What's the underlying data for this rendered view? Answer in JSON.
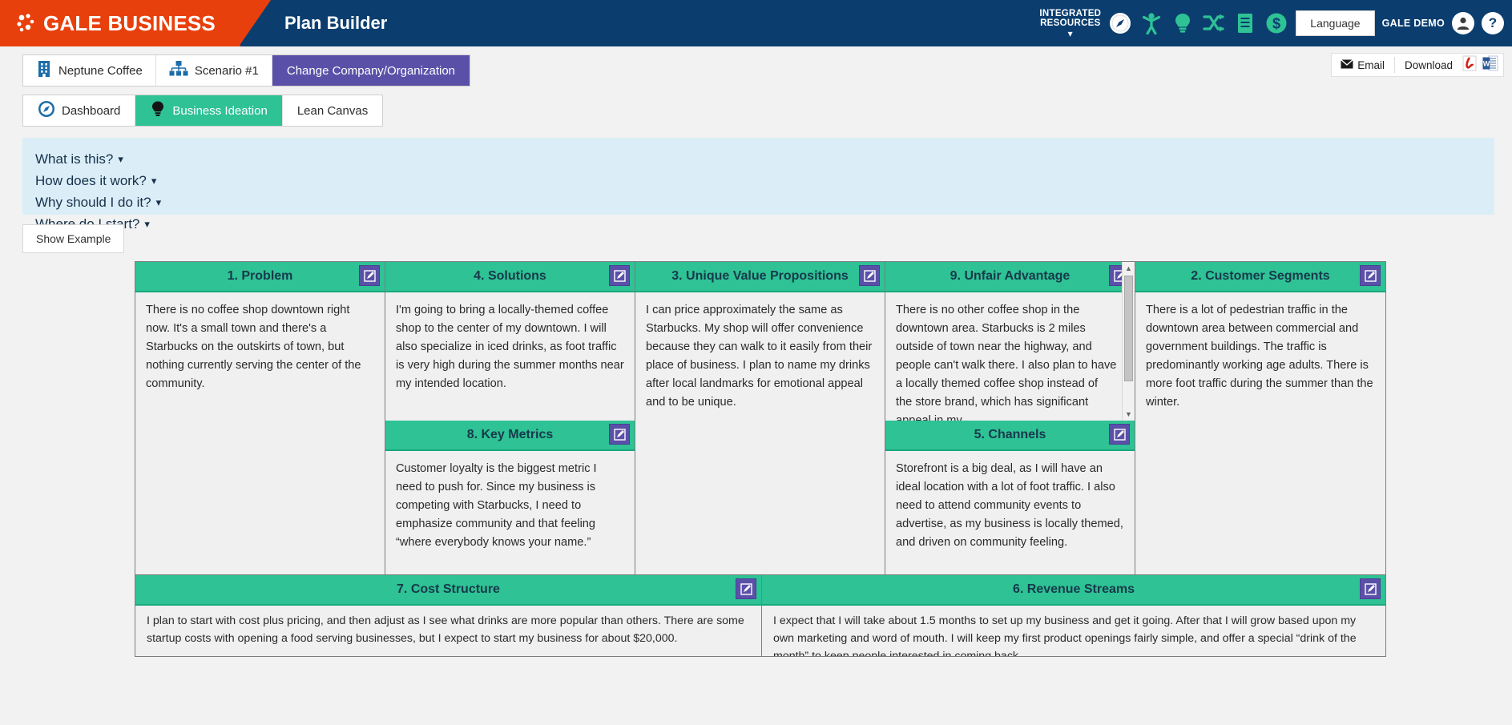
{
  "header": {
    "brand": "GALE BUSINESS",
    "app_title": "Plan Builder",
    "integrated_resources_line1": "INTEGRATED",
    "integrated_resources_line2": "RESOURCES",
    "chevron": "⌄",
    "icons": [
      "compass-icon",
      "person-icon",
      "lightbulb-icon",
      "shuffle-icon",
      "document-icon",
      "dollar-icon"
    ],
    "language_label": "Language",
    "user_label": "GALE DEMO",
    "help_label": "?",
    "brand_color": "#e8400c",
    "bar_color": "#0b3e6f"
  },
  "context": {
    "company": "Neptune Coffee",
    "scenario": "Scenario #1",
    "change_button": "Change Company/Organization",
    "change_button_color": "#5b50a8",
    "email_label": "Email",
    "download_label": "Download",
    "download_formats": [
      "pdf-icon",
      "word-icon"
    ]
  },
  "tabs": [
    {
      "label": "Dashboard",
      "icon": "compass-icon",
      "active": false
    },
    {
      "label": "Business Ideation",
      "icon": "lightbulb-icon",
      "active": true
    },
    {
      "label": "Lean Canvas",
      "icon": "",
      "active": false
    }
  ],
  "info_panel": {
    "background": "#dbeef7",
    "links": [
      "What is this?",
      "How does it work?",
      "Why should I do it?",
      "Where do I start?"
    ]
  },
  "show_example_label": "Show Example",
  "canvas": {
    "accent": "#2ec295",
    "edit_icon": "edit-pencil-icon",
    "columns": [
      {
        "cards": [
          {
            "title": "1. Problem",
            "body": "There is no coffee shop downtown right now. It's a small town and there's a Starbucks on the outskirts of town, but nothing currently serving the center of the community.",
            "scroll": false
          }
        ]
      },
      {
        "cards": [
          {
            "title": "4. Solutions",
            "body": "I'm going to bring a locally-themed coffee shop to the center of my downtown. I will also specialize in iced drinks, as foot traffic is very high during the summer months near my intended location.",
            "scroll": false
          },
          {
            "title": "8. Key Metrics",
            "body": "Customer loyalty is the biggest metric I need to push for.  Since my business is competing with Starbucks, I need to emphasize community and that feeling “where everybody knows your name.”",
            "scroll": false
          }
        ]
      },
      {
        "cards": [
          {
            "title": "3. Unique Value Propositions",
            "body": "I can price approximately the same as Starbucks.  My shop will offer convenience because they can walk to it easily from their place of business. I plan to name my drinks after local landmarks for emotional appeal and to be unique.",
            "scroll": false
          }
        ]
      },
      {
        "cards": [
          {
            "title": "9. Unfair Advantage",
            "body": "There is no other coffee shop in the downtown area.  Starbucks is 2 miles outside of town near the highway, and people can't walk there. I also plan to have a locally themed coffee shop instead of the store brand, which has significant appeal in my",
            "scroll": true
          },
          {
            "title": "5. Channels",
            "body": "Storefront is a big deal, as I will have an ideal location with a lot of foot traffic.  I also need to attend community events to advertise, as my business is locally themed, and driven on community feeling.",
            "scroll": false
          }
        ]
      },
      {
        "cards": [
          {
            "title": "2. Customer Segments",
            "body": "There is a lot of pedestrian traffic in the downtown area between commercial and government buildings.  The traffic is predominantly working age adults.  There is more foot traffic during the summer than the winter.",
            "scroll": false
          }
        ]
      }
    ],
    "bottom": [
      {
        "title": "7. Cost Structure",
        "body": "I plan to start with cost plus pricing, and then adjust as I see what drinks are more popular than others.  There are some startup costs with opening a food serving businesses, but I expect to start my business for about $20,000."
      },
      {
        "title": "6. Revenue Streams",
        "body": "I expect that I will take about 1.5 months to set up my business and get it going.  After that I will grow based upon my own marketing and word of mouth.  I will keep my first product openings fairly simple, and offer a special “drink of the month” to keep people interested in coming back."
      }
    ]
  }
}
